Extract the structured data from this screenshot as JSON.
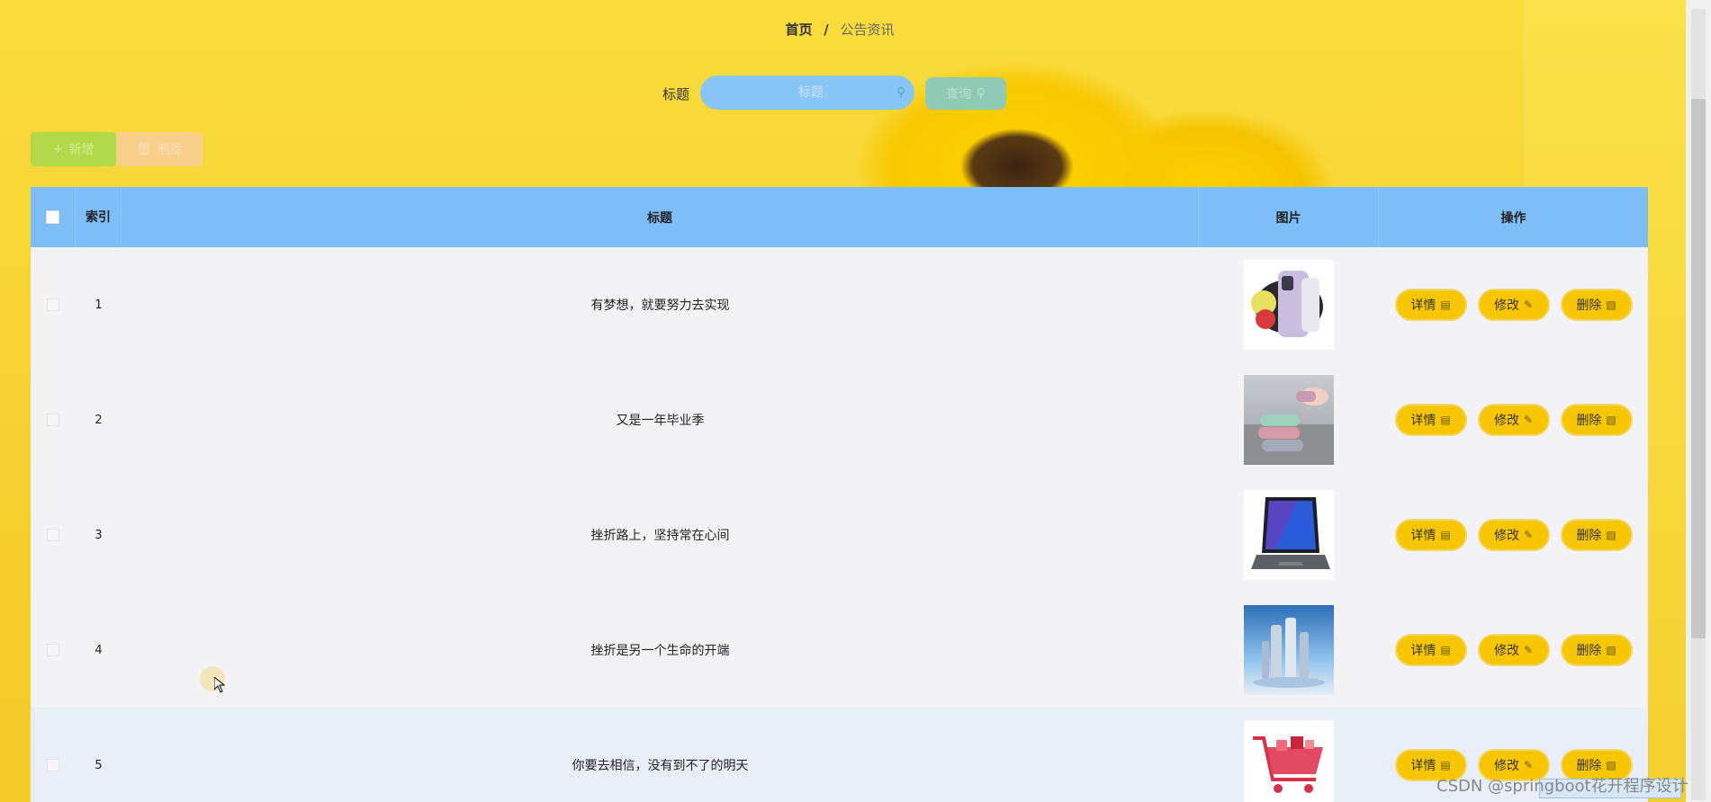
{
  "breadcrumb": {
    "home": "首页",
    "separator": "/",
    "current": "公告资讯"
  },
  "search": {
    "label": "标题",
    "placeholder": "标题",
    "query_label": "查询"
  },
  "toolbar": {
    "add_label": "新增",
    "delete_label": "删除"
  },
  "table": {
    "headers": {
      "index": "索引",
      "title": "标题",
      "image": "图片",
      "actions": "操作"
    },
    "rows": [
      {
        "index": "1",
        "title": "有梦想，就要努力去实现",
        "image": "phone-image"
      },
      {
        "index": "2",
        "title": "又是一年毕业季",
        "image": "towels-image"
      },
      {
        "index": "3",
        "title": "挫折路上，坚持常在心间",
        "image": "laptop-image"
      },
      {
        "index": "4",
        "title": "挫折是另一个生命的开端",
        "image": "cosmetics-image"
      },
      {
        "index": "5",
        "title": "你要去相信，没有到不了的明天",
        "image": "shopping-cart-image"
      }
    ],
    "actions": {
      "detail": "详情",
      "edit": "修改",
      "delete": "删除"
    }
  },
  "watermark": "CSDN @springboot花开程序设计",
  "colors": {
    "header_bg": "#7dbef8",
    "action_button": "#f7c600",
    "search_bg": "#87c6f7",
    "add_button": "#b2d94a",
    "delete_button": "#f9d08a"
  }
}
